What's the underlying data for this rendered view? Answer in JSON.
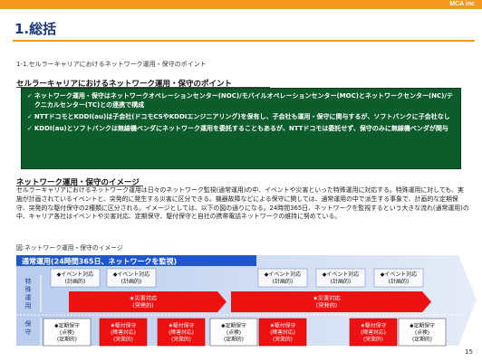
{
  "header": {
    "brand": "MCA inc"
  },
  "page": {
    "title": "1.総括",
    "subtitle": "1-1.セルラーキャリアにおけるネットワーク運用・保守のポイント",
    "number": "15"
  },
  "section1": {
    "heading": "セルラーキャリアにおけるネットワーク運用・保守のポイント",
    "bullets": [
      "ネットワーク運用・保守はネットワークオペレーションセンター(NOC)/モバイルオペレーションセンター(MOC)とネットワークセンター(NC)/テクニカルセンター(TC)との連携で構成",
      "NTTドコモとKDDI(au)は子会社(ドコモCSやKDDIエンジニアリング)を保有し、子会社も運用・保守に関与するが、ソフトバンクに子会社なし",
      "KDDI(au)とソフトバンクは無線機ベンダにネットワーク運用を委託することもあるが、NTTドコモは委託せず、保守のみに無線機ベンダが関与"
    ]
  },
  "section2": {
    "heading": "ネットワーク運用・保守のイメージ",
    "paragraph": "セルラーキャリアにおけるネットワーク運用は日々のネットワーク監視(通常運用)の中、イベントや災害といった特殊運用に対応する。特殊運用に対しても、実施が計画されているイベントと、突発的に発生する災害に区分できる。機器故障などによる保守に関しては、通常運用の中で派生する事象で、計画的な定期保守、突発的な駆付保守の2種類に区分される。イメージとしては、以下の図の通りになる。24時間365日、ネットワークを監視するという大きな流れ(通常運用)の中、キャリア各社はイベントや災害対応、定期保守、駆付保守と自社の携帯電話ネットワークの維持に努めている。"
  },
  "figure": {
    "caption": "図:ネットワーク運用・保守のイメージ",
    "banner": "通常運用(24時間365日、ネットワークを監視)",
    "row_label_special": "特殊運用",
    "row_label_maint": "保守",
    "events": [
      "◆イベント対応(計画的)",
      "◆イベント対応(計画的)",
      "◆イベント対応(計画的)",
      "◆イベント対応(計画的)",
      "◆イベント対応(計画的)"
    ],
    "disasters": [
      "★災害対応(突発的)",
      "★災害対応(突発的)"
    ],
    "maintenance": [
      {
        "label": "◆定期保守(点検)(定期的)",
        "type": "regular"
      },
      {
        "label": "★駆付保守(障害対応)(突発的)",
        "type": "urgent"
      },
      {
        "label": "★駆付保守(障害対応)(突発的)",
        "type": "urgent"
      },
      {
        "label": "◆定期保守(点検)(定期的)",
        "type": "regular"
      },
      {
        "label": "★駆付保守(障害対応)(突発的)",
        "type": "urgent"
      },
      {
        "label": "★駆付保守(障害対応)(突発的)",
        "type": "urgent"
      },
      {
        "label": "◆定期保守(点検)(定期的)",
        "type": "regular"
      }
    ]
  },
  "colors": {
    "accent": "#f39a1e",
    "title": "#1f3a7a",
    "green_box": "#0d5c2b",
    "banner": "#1e57c8",
    "event_fill": "#f7f9fd",
    "red_fill": "#ee1111"
  }
}
